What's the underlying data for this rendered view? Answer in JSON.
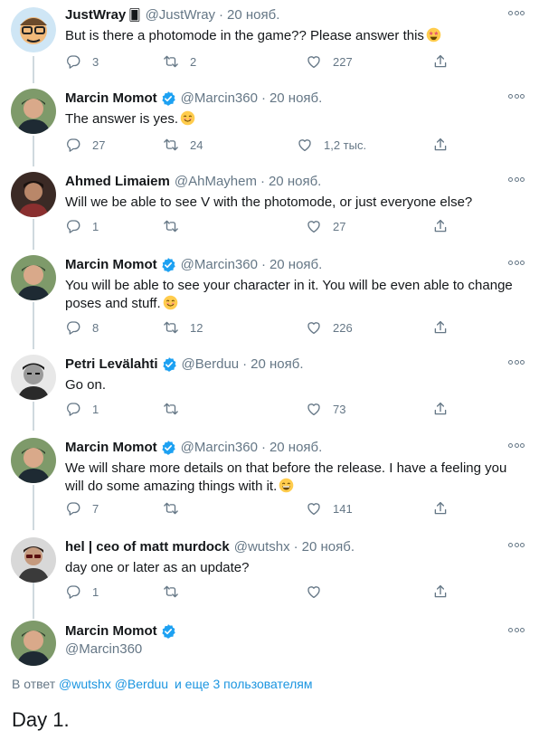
{
  "colors": {
    "link": "#1b95e0",
    "muted": "#657786",
    "text": "#14171a",
    "verified": "#1da1f2"
  },
  "tweets": [
    {
      "name": "JustWray",
      "badge": "🂠",
      "handle": "@JustWray",
      "date": "20 нояб.",
      "text": "But is there a photomode in the game?? Please answer this",
      "emoji": "star-struck-emoji",
      "replies": "3",
      "retweets": "2",
      "likes": "227",
      "verified": false
    },
    {
      "name": "Marcin Momot",
      "handle": "@Marcin360",
      "date": "20 нояб.",
      "text": "The answer is yes.",
      "emoji": "smiling-emoji",
      "replies": "27",
      "retweets": "24",
      "likes": "1,2 тыс.",
      "verified": true
    },
    {
      "name": "Ahmed Limaiem",
      "handle": "@AhMayhem",
      "date": "20 нояб.",
      "text": "Will we be able to see V with the photomode, or just everyone else?",
      "replies": "1",
      "retweets": "",
      "likes": "27",
      "verified": false
    },
    {
      "name": "Marcin Momot",
      "handle": "@Marcin360",
      "date": "20 нояб.",
      "text": "You will be able to see your character in it. You will be even able to change poses and stuff.",
      "emoji": "smiling-emoji",
      "replies": "8",
      "retweets": "12",
      "likes": "226",
      "verified": true
    },
    {
      "name": "Petri Levälahti",
      "handle": "@Berduu",
      "date": "20 нояб.",
      "text": "Go on.",
      "replies": "1",
      "retweets": "",
      "likes": "73",
      "verified": true
    },
    {
      "name": "Marcin Momot",
      "handle": "@Marcin360",
      "date": "20 нояб.",
      "text": "We will share more details on that before the release. I have a feeling you will do some amazing things with it.",
      "emoji": "grinning-emoji",
      "replies": "7",
      "retweets": "",
      "likes": "141",
      "verified": true
    },
    {
      "name": "hel | ceo of matt murdock",
      "handle": "@wutshx",
      "date": "20 нояб.",
      "text": "day one or later as an update?",
      "replies": "1",
      "retweets": "",
      "likes": "",
      "verified": false
    }
  ],
  "main_tweet": {
    "name": "Marcin Momot",
    "handle": "@Marcin360",
    "reply_prefix": "В ответ",
    "mention1": "@wutshx",
    "mention2": "@Berduu",
    "reply_suffix": "и еще 3 пользователям",
    "text": "Day 1."
  }
}
